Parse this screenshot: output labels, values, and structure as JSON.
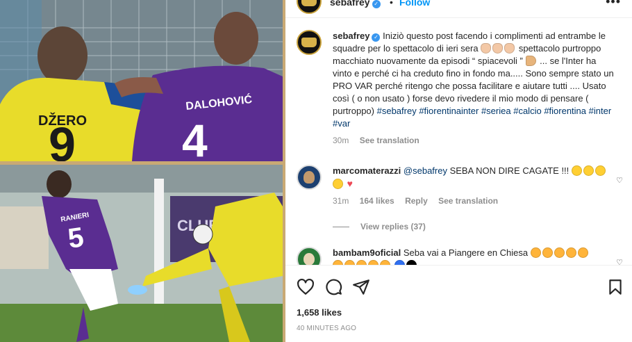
{
  "header": {
    "username": "sebafrey",
    "separator": "•",
    "follow_label": "Follow",
    "more_icon": "more-horizontal-icon"
  },
  "media": {
    "top_frame": {
      "jersey_left_name": "DŽERO",
      "jersey_left_number": "9",
      "jersey_right_name": "DALOHOVIĆ",
      "jersey_right_number": "4"
    },
    "bottom_frame": {
      "player_name": "RANIERI",
      "player_number": "5",
      "board_text": "CLUB"
    },
    "colors": {
      "frame": "#c9a974",
      "yellow_kit": "#e8dc2a",
      "purple_kit": "#5a2d91"
    }
  },
  "caption": {
    "username": "sebafrey",
    "line1": "Iniziò questo post facendo i complimenti ad entrambe le squadre per lo spettacolo di ieri sera",
    "line2": "spettacolo purtroppo macchiato nuovamente da episodi “ spiacevoli ”",
    "line3": "... se l'Inter ha vinto e perché ci ha creduto fino in fondo ma..... Sono sempre stato un PRO VAR perché ritengo che possa facilitare e aiutare tutti .... Usato così ( o non usato ) forse devo rivedere il mio modo di pensare ( purtroppo)",
    "hashtags": [
      "#sebafrey",
      "#fiorentinainter",
      "#seriea",
      "#calcio",
      "#fiorentina",
      "#inter",
      "#var"
    ],
    "time": "30m",
    "translate": "See translation"
  },
  "comments": [
    {
      "username": "marcomaterazzi",
      "mention": "@sebafrey",
      "text": "SEBA NON DIRE CAGATE !!!",
      "time": "31m",
      "likes": "164 likes",
      "reply": "Reply",
      "translate": "See translation",
      "view_replies": "View replies (37)"
    },
    {
      "username": "bambam9oficial",
      "text": "Seba vai a Piangere en Chiesa"
    }
  ],
  "actions": {
    "icons": [
      "heart-icon",
      "comment-icon",
      "share-icon",
      "bookmark-icon"
    ],
    "likes": "1,658 likes",
    "time_ago": "40 MINUTES AGO"
  }
}
